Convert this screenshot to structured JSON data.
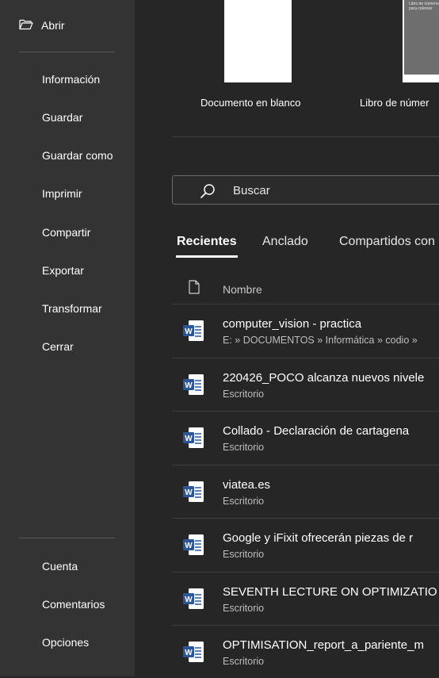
{
  "sidebar": {
    "open_label": "Abrir",
    "items": [
      {
        "label": "Información"
      },
      {
        "label": "Guardar"
      },
      {
        "label": "Guardar como"
      },
      {
        "label": "Imprimir"
      },
      {
        "label": "Compartir"
      },
      {
        "label": "Exportar"
      },
      {
        "label": "Transformar"
      },
      {
        "label": "Cerrar"
      }
    ],
    "bottom_items": [
      {
        "label": "Cuenta"
      },
      {
        "label": "Comentarios"
      },
      {
        "label": "Opciones"
      }
    ]
  },
  "templates": [
    {
      "label": "Documento en blanco"
    },
    {
      "label": "Libro de númer",
      "thumbnail_text": "Libro de números para colorear"
    }
  ],
  "search": {
    "placeholder": "Buscar"
  },
  "tabs": [
    {
      "label": "Recientes",
      "active": true
    },
    {
      "label": "Anclado"
    },
    {
      "label": "Compartidos con"
    }
  ],
  "file_list": {
    "column_name": "Nombre",
    "files": [
      {
        "name": "computer_vision - practica",
        "path": "E: » DOCUMENTOS » Informática » codio »"
      },
      {
        "name": "220426_POCO alcanza nuevos nivele",
        "path": "Escritorio"
      },
      {
        "name": "Collado - Declaración de cartagena",
        "path": "Escritorio"
      },
      {
        "name": "viatea.es",
        "path": "Escritorio"
      },
      {
        "name": "Google y iFixit ofrecerán piezas de r",
        "path": "Escritorio"
      },
      {
        "name": "SEVENTH LECTURE ON OPTIMIZATIO",
        "path": "Escritorio"
      },
      {
        "name": "OPTIMISATION_report_a_pariente_m",
        "path": "Escritorio"
      }
    ]
  },
  "colors": {
    "sidebar_bg": "#333333",
    "main_bg": "#262626",
    "word_blue": "#2b579a"
  },
  "icons": {
    "open": "folder-open-icon",
    "search": "search-icon",
    "file_header": "document-icon",
    "word_file": "word-document-icon"
  }
}
